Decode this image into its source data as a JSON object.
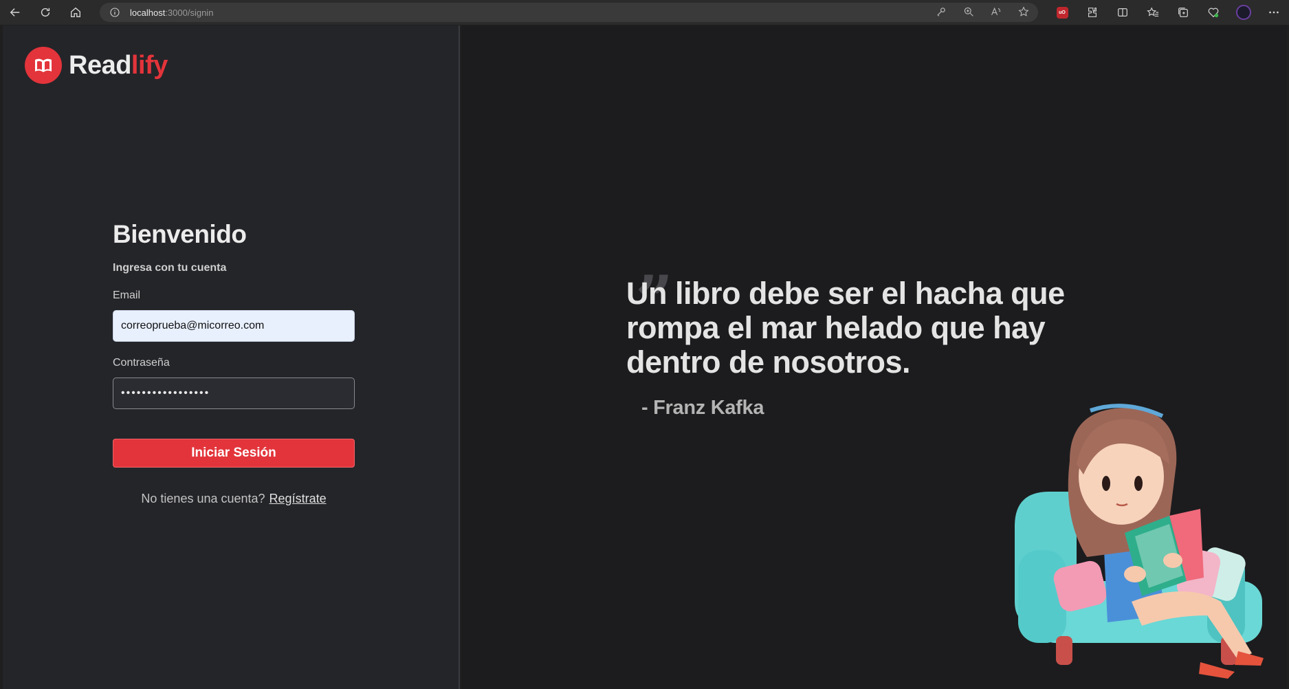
{
  "browser": {
    "url_host": "localhost",
    "url_path": ":3000/signin"
  },
  "brand": {
    "name_main": "Read",
    "name_accent": "lify",
    "accent_color": "#e3343b"
  },
  "login": {
    "title": "Bienvenido",
    "subtitle": "Ingresa con tu cuenta",
    "email_label": "Email",
    "email_value": "correoprueba@micorreo.com",
    "password_label": "Contraseña",
    "password_value": "•••••••••••••••••",
    "submit_label": "Iniciar Sesión",
    "signup_prompt": "No tienes una cuenta?",
    "signup_link": "Regístrate"
  },
  "hero": {
    "quote_mark": "”",
    "quote": "Un libro debe ser el hacha que rompa el mar helado que hay dentro de nosotros.",
    "author": "- Franz Kafka"
  },
  "icons": [
    "back-icon",
    "reload-icon",
    "home-icon",
    "info-icon",
    "key-icon",
    "zoom-icon",
    "read-aloud-icon",
    "star-icon",
    "ublock-icon",
    "extensions-icon",
    "split-screen-icon",
    "favorites-icon",
    "collections-icon",
    "performance-icon",
    "profile-icon",
    "more-icon"
  ]
}
